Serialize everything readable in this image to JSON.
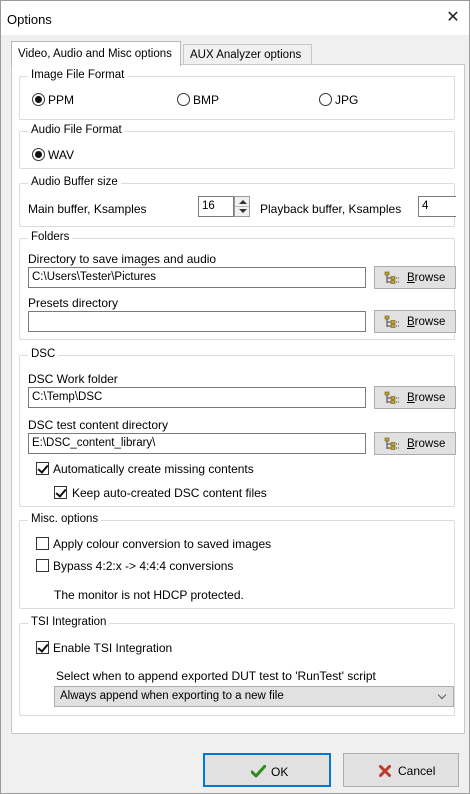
{
  "window": {
    "title": "Options",
    "close_glyph": "✕"
  },
  "tabs": [
    {
      "label": "Video, Audio and Misc options",
      "active": true
    },
    {
      "label": "AUX Analyzer options",
      "active": false
    }
  ],
  "image_format": {
    "legend": "Image File Format",
    "options": [
      {
        "label": "PPM",
        "checked": true
      },
      {
        "label": "BMP",
        "checked": false
      },
      {
        "label": "JPG",
        "checked": false
      }
    ]
  },
  "audio_format": {
    "legend": "Audio File Format",
    "options": [
      {
        "label": "WAV",
        "checked": true
      }
    ]
  },
  "audio_buffer": {
    "legend": "Audio Buffer size",
    "main_label": "Main buffer, Ksamples",
    "main_value": "16",
    "playback_label": "Playback buffer, Ksamples",
    "playback_value": "4"
  },
  "folders": {
    "legend": "Folders",
    "save_dir_label": "Directory to save images and audio",
    "save_dir_value": "C:\\Users\\Tester\\Pictures",
    "presets_label": "Presets directory",
    "presets_value": "",
    "browse_label": "Browse"
  },
  "dsc": {
    "legend": "DSC",
    "work_label": "DSC Work folder",
    "work_value": "C:\\Temp\\DSC",
    "content_label": "DSC test content directory",
    "content_value": "E:\\DSC_content_library\\",
    "browse_label": "Browse",
    "auto_create_label": "Automatically create missing contents",
    "auto_create_checked": true,
    "keep_label": "Keep auto-created DSC content files",
    "keep_checked": true
  },
  "misc": {
    "legend": "Misc. options",
    "colour_label": "Apply colour conversion to saved images",
    "colour_checked": false,
    "bypass_label": "Bypass 4:2:x -> 4:4:4 conversions",
    "bypass_checked": false,
    "hdcp_status": "The monitor is not HDCP protected."
  },
  "tsi": {
    "legend": "TSI Integration",
    "enable_label": "Enable TSI Integration",
    "enable_checked": true,
    "select_label": "Select when to append exported DUT test to 'RunTest' script",
    "select_value": "Always append when exporting to a new file"
  },
  "buttons": {
    "ok": "OK",
    "cancel": "Cancel"
  },
  "colors": {
    "accent": "#0078d7",
    "ok_check": "#2e8b1e",
    "cancel_x": "#c0392b"
  }
}
